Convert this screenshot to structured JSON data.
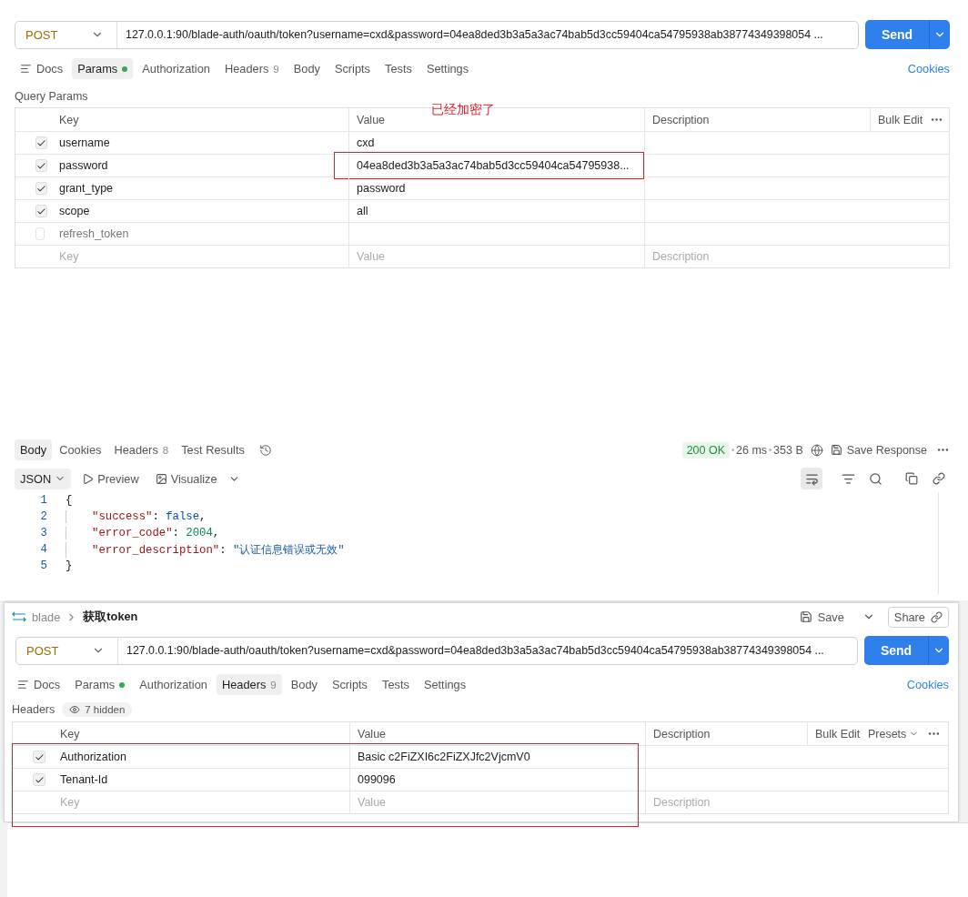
{
  "request": {
    "method": "POST",
    "url": "127.0.0.1:90/blade-auth/oauth/token?username=cxd&password=04ea8ded3b3a5a3ac74bab5d3cc59404ca54795938ab38774349398054 ...",
    "send": "Send",
    "tabs": [
      {
        "label": "Docs",
        "kind": "docs",
        "selected": false
      },
      {
        "label": "Params",
        "dot": true,
        "selected": true
      },
      {
        "label": "Authorization",
        "selected": false
      },
      {
        "label": "Headers",
        "count": "9",
        "selected": false
      },
      {
        "label": "Body",
        "selected": false
      },
      {
        "label": "Scripts",
        "selected": false
      },
      {
        "label": "Tests",
        "selected": false
      },
      {
        "label": "Settings",
        "selected": false
      }
    ],
    "cookies": "Cookies",
    "section_label": "Query Params",
    "table": {
      "columns": [
        "Key",
        "Value",
        "Description"
      ],
      "actions": [
        "Bulk Edit"
      ],
      "rows": [
        {
          "key": "username",
          "value": "cxd",
          "checked": true,
          "annotated": false
        },
        {
          "key": "password",
          "value": "04ea8ded3b3a5a3ac74bab5d3cc59404ca54795938...",
          "checked": true,
          "annotated": true
        },
        {
          "key": "grant_type",
          "value": "password",
          "checked": true,
          "annotated": false
        },
        {
          "key": "scope",
          "value": "all",
          "checked": true,
          "annotated": false
        },
        {
          "key": "refresh_token",
          "value": "",
          "checked": false,
          "annotated": false
        }
      ],
      "new_row": {
        "key": {
          "placeholder": "Key"
        },
        "value": {
          "placeholder": "Value"
        },
        "description": {
          "placeholder": "Description"
        }
      }
    },
    "note": "已经加密了"
  },
  "response": {
    "tabs": [
      {
        "label": "Body",
        "selected": true
      },
      {
        "label": "Cookies",
        "selected": false
      },
      {
        "label": "Headers",
        "count": "8",
        "selected": false
      },
      {
        "label": "Test Results",
        "selected": false
      }
    ],
    "status": "200 OK",
    "time": "26 ms",
    "size": "353 B",
    "save_response": "Save Response",
    "format": "JSON",
    "views": [
      {
        "label": "Preview",
        "kind": "preview"
      },
      {
        "label": "Visualize",
        "kind": "visualize"
      }
    ],
    "code_lines": [
      {
        "number": "1",
        "tokens": [
          {
            "kind": "punct",
            "text": "{"
          }
        ]
      },
      {
        "number": "2",
        "tokens": [
          {
            "kind": "key",
            "text": "\"success\""
          },
          {
            "kind": "punct",
            "text": ": "
          },
          {
            "kind": "bool",
            "text": "false"
          },
          {
            "kind": "punct",
            "text": ","
          }
        ]
      },
      {
        "number": "3",
        "tokens": [
          {
            "kind": "key",
            "text": "\"error_code\""
          },
          {
            "kind": "punct",
            "text": ": "
          },
          {
            "kind": "number",
            "text": "2004"
          },
          {
            "kind": "punct",
            "text": ","
          }
        ]
      },
      {
        "number": "4",
        "tokens": [
          {
            "kind": "key",
            "text": "\"error_description\""
          },
          {
            "kind": "punct",
            "text": ": "
          },
          {
            "kind": "string",
            "text": "\"认证信息错误或无效\""
          }
        ]
      },
      {
        "number": "5",
        "tokens": [
          {
            "kind": "punct",
            "text": "}"
          }
        ]
      }
    ]
  },
  "request2": {
    "breadcrumb": [
      "blade",
      "获取token"
    ],
    "save": "Save",
    "share": "Share",
    "method": "POST",
    "url": "127.0.0.1:90/blade-auth/oauth/token?username=cxd&password=04ea8ded3b3a5a3ac74bab5d3cc59404ca54795938ab38774349398054 ...",
    "send": "Send",
    "tabs": [
      {
        "label": "Docs",
        "kind": "docs",
        "selected": false
      },
      {
        "label": "Params",
        "dot": true,
        "selected": false
      },
      {
        "label": "Authorization",
        "selected": false
      },
      {
        "label": "Headers",
        "count": "9",
        "selected": true
      },
      {
        "label": "Body",
        "selected": false
      },
      {
        "label": "Scripts",
        "selected": false
      },
      {
        "label": "Tests",
        "selected": false
      },
      {
        "label": "Settings",
        "selected": false
      }
    ],
    "cookies": "Cookies",
    "section_label": "Headers",
    "hidden": "7 hidden",
    "table": {
      "columns": [
        "Key",
        "Value",
        "Description"
      ],
      "actions": [
        "Bulk Edit",
        "Presets"
      ],
      "annotated": true,
      "rows": [
        {
          "key": "Authorization",
          "value": "Basic c2FiZXI6c2FiZXJfc2VjcmV0",
          "checked": true
        },
        {
          "key": "Tenant-Id",
          "value": "099096",
          "checked": true
        }
      ],
      "new_row": {
        "key": {
          "placeholder": "Key"
        },
        "value": {
          "placeholder": "Value"
        },
        "description": {
          "placeholder": "Description"
        }
      }
    }
  }
}
